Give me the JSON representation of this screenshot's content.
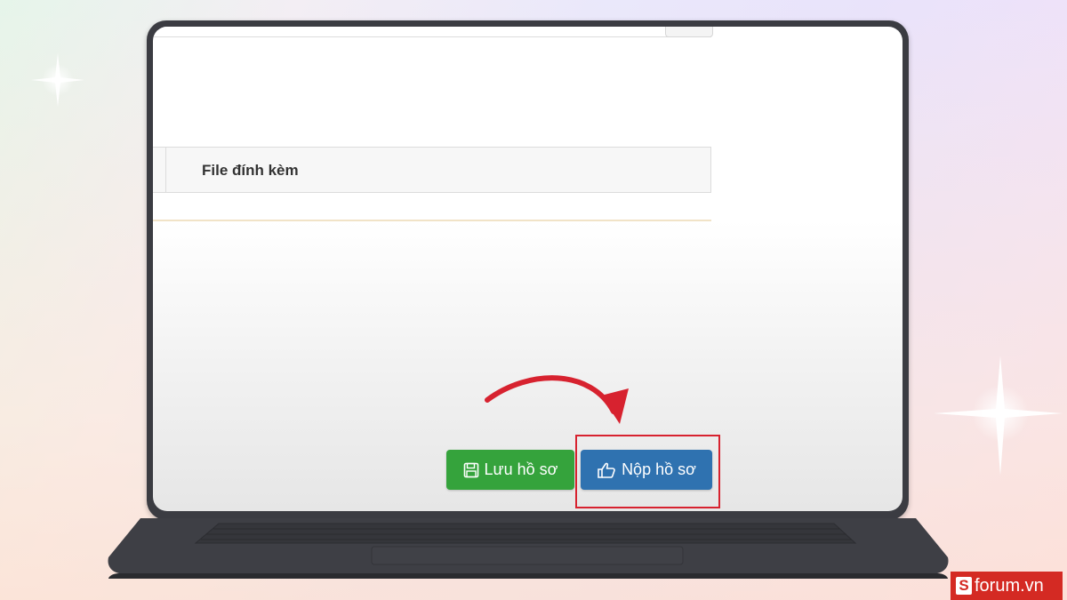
{
  "form": {
    "attachment_header": "File đính kèm"
  },
  "actions": {
    "save_label": "Lưu hồ sơ",
    "submit_label": "Nộp hồ sơ"
  },
  "icons": {
    "save": "floppy-disk-icon",
    "submit": "thumbs-up-icon",
    "annotation_arrow": "curved-arrow-icon"
  },
  "watermark": {
    "logo_letter": "S",
    "text": "forum.vn"
  },
  "colors": {
    "save_button": "#35a33c",
    "submit_button": "#2f72b0",
    "highlight": "#d7222f",
    "laptop_body": "#3b3c42",
    "watermark_bg": "#d42a23"
  }
}
